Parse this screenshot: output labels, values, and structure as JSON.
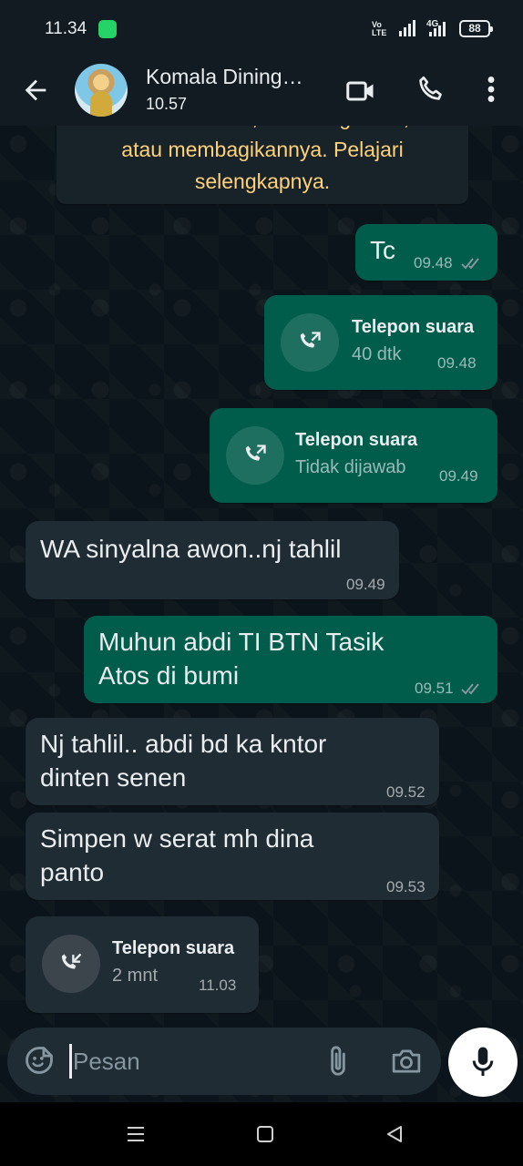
{
  "status_bar": {
    "time": "11.34",
    "network_volte": "Vo LTE",
    "network_4g": "4G",
    "battery": "88"
  },
  "header": {
    "contact_name": "Komala Dining…",
    "contact_status": "10.57"
  },
  "system_notice": {
    "lines": [
      "bisa membaca, mendengarkan,",
      "atau membagikannya. Pelajari",
      "selengkapnya."
    ]
  },
  "messages": [
    {
      "type": "text",
      "direction": "out",
      "text": "Tc",
      "time": "09.48",
      "status": "read"
    },
    {
      "type": "call",
      "direction": "out",
      "title": "Telepon suara",
      "detail": "40 dtk",
      "time": "09.48",
      "icon": "outgoing-call-icon"
    },
    {
      "type": "call",
      "direction": "out",
      "title": "Telepon suara",
      "detail": "Tidak dijawab",
      "time": "09.49",
      "icon": "outgoing-call-icon"
    },
    {
      "type": "text",
      "direction": "in",
      "text": "WA sinyalna awon..nj tahlil",
      "time": "09.49"
    },
    {
      "type": "text",
      "direction": "out",
      "lines": [
        "Muhun abdi TI BTN Tasik",
        "Atos di bumi"
      ],
      "time": "09.51",
      "status": "read"
    },
    {
      "type": "text",
      "direction": "in",
      "lines": [
        "Nj tahlil.. abdi bd ka kntor",
        "dinten senen"
      ],
      "time": "09.52"
    },
    {
      "type": "text",
      "direction": "in",
      "lines": [
        "Simpen w serat mh dina",
        "panto"
      ],
      "time": "09.53"
    },
    {
      "type": "call",
      "direction": "in",
      "title": "Telepon suara",
      "detail": "2 mnt",
      "time": "11.03",
      "icon": "incoming-call-icon"
    }
  ],
  "composer": {
    "placeholder": "Pesan"
  },
  "colors": {
    "outgoing_bubble": "#005c4b",
    "incoming_bubble": "#202c33",
    "background": "#0b141a",
    "read_ticks": "#8696a0",
    "notice_text": "#ffd279"
  }
}
